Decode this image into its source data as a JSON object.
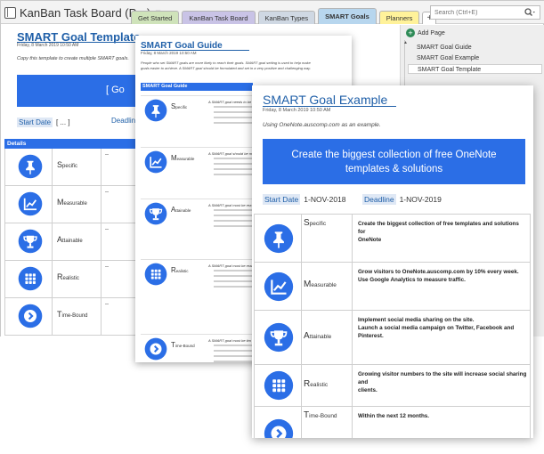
{
  "app": {
    "notebook_title": "KanBan Task Board (Pro)",
    "tabs": [
      {
        "label": "Get Started",
        "color": "#cfe3ba",
        "active": false
      },
      {
        "label": "KanBan Task Board",
        "color": "#c9c3e6",
        "active": false
      },
      {
        "label": "KanBan Types",
        "color": "#cfd8e3",
        "active": false
      },
      {
        "label": "SMART Goals",
        "color": "#b7d6ee",
        "active": true
      },
      {
        "label": "Planners",
        "color": "#fff29a",
        "active": false
      }
    ],
    "add_tab_label": "+",
    "search_placeholder": "Search (Ctrl+E)"
  },
  "sidebar": {
    "add_page_label": "Add Page",
    "pages": [
      {
        "label": "SMART Goal Guide",
        "active": false
      },
      {
        "label": "SMART Goal Example",
        "active": false
      },
      {
        "label": "SMART Goal Template",
        "active": true
      }
    ]
  },
  "template_page": {
    "title": "SMART Goal Template",
    "date": "Friday, 8 March 2019     10:50 AM",
    "note": "Copy this template to create multiple SMART goals.",
    "banner_text": "[   Go",
    "start_label": "Start Date",
    "start_value": "[   ...   ]",
    "deadline_label": "Deadline",
    "details_label": "Details",
    "rows": [
      {
        "initial": "S",
        "rest": "pecific",
        "value": "--"
      },
      {
        "initial": "M",
        "rest": "easurable",
        "value": "--"
      },
      {
        "initial": "A",
        "rest": "ttainable",
        "value": "--"
      },
      {
        "initial": "R",
        "rest": "ealistic",
        "value": "--"
      },
      {
        "initial": "T",
        "rest": "ime-Bound",
        "value": "--"
      }
    ]
  },
  "guide_page": {
    "title": "SMART Goal Guide",
    "date": "Friday, 8 March 2019     10:50 AM",
    "intro1": "People who set SMART goals are more likely to reach their goals. SMART goal setting is used to help make",
    "intro2": "goals easier to achieve. A SMART goal should be formulated and set in a very positive and challenging way.",
    "header": "SMART Goal Guide",
    "rows": [
      {
        "initial": "S",
        "rest": "pecific",
        "question": "A SMART goal needs to be"
      },
      {
        "initial": "M",
        "rest": "easurable",
        "question": "A SMART goal should be me"
      },
      {
        "initial": "A",
        "rest": "ttainable",
        "question": "A SMART goal must be rea"
      },
      {
        "initial": "R",
        "rest": "ealistic",
        "question": "A SMART goal must be reali"
      },
      {
        "initial": "T",
        "rest": "ime-Bound",
        "question": "A SMART goal must be tim"
      }
    ]
  },
  "example_page": {
    "title": "SMART Goal Example",
    "date": "Friday, 8 March 2019     10:50 AM",
    "note": "Using OneNote.auscomp.com as an example.",
    "banner_line1": "Create the biggest collection of free OneNote",
    "banner_line2": "templates & solutions",
    "start_label": "Start Date",
    "start_value": "1-NOV-2018",
    "deadline_label": "Deadline",
    "deadline_value": "1-NOV-2019",
    "rows": [
      {
        "initial": "S",
        "rest": "pecific",
        "lines": [
          "Create the biggest collection of free templates and solutions for",
          "OneNote"
        ]
      },
      {
        "initial": "M",
        "rest": "easurable",
        "lines": [
          "Grow visitors to OneNote.auscomp.com by 10% every week.",
          "Use Google Analytics to measure traffic."
        ]
      },
      {
        "initial": "A",
        "rest": "ttainable",
        "lines": [
          "Implement social media sharing on the site.",
          "Launch a social media campaign on Twitter, Facebook and",
          "Pinterest."
        ]
      },
      {
        "initial": "R",
        "rest": "ealistic",
        "lines": [
          "Growing visitor numbers to the site will increase social sharing and",
          "clients."
        ]
      },
      {
        "initial": "T",
        "rest": "ime-Bound",
        "lines": [
          "Within the next 12 months."
        ]
      }
    ]
  },
  "icons": [
    "pin-icon",
    "chart-icon",
    "trophy-icon",
    "grid-icon",
    "chevron-right-icon"
  ],
  "colors": {
    "accent": "#2b6ee6",
    "title": "#1f5fa8"
  }
}
